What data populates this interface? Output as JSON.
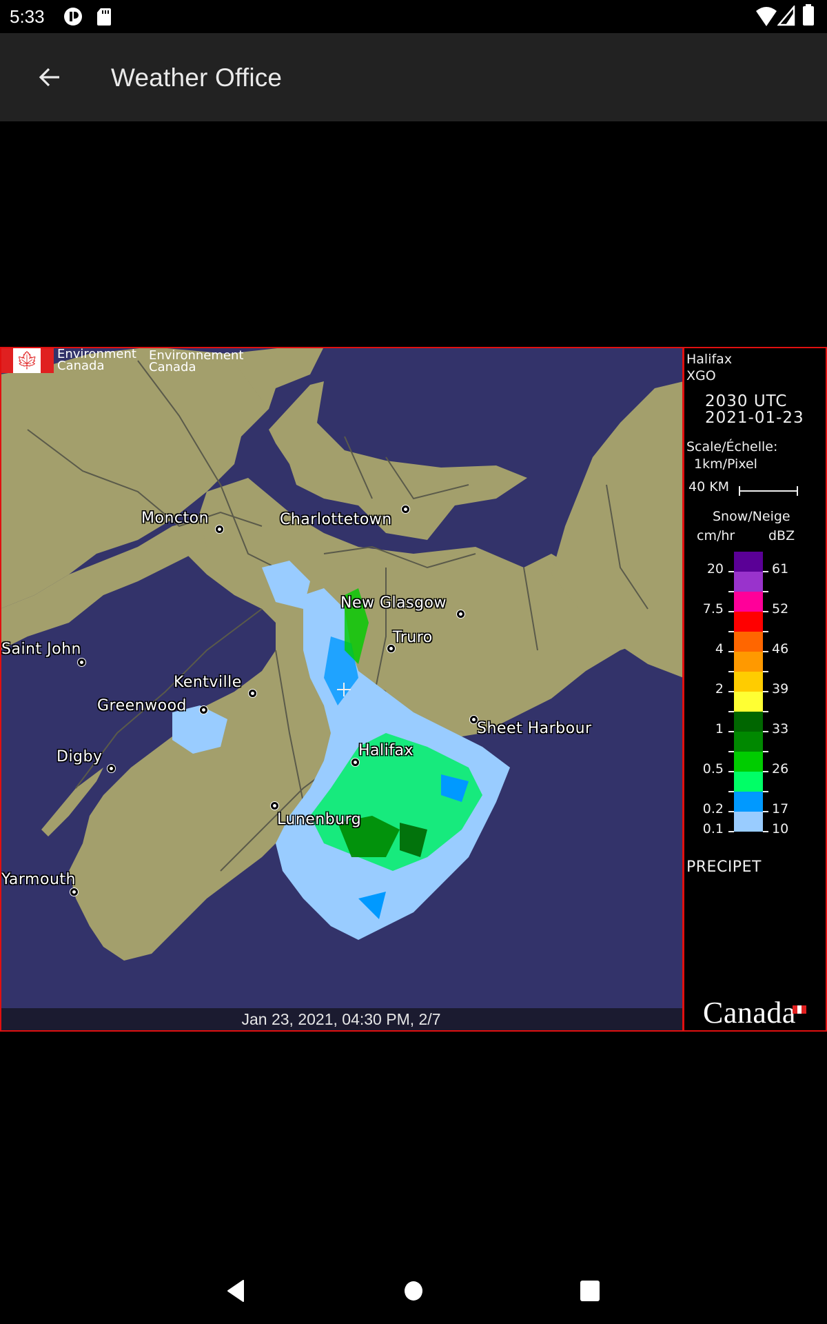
{
  "status_bar": {
    "time": "5:33",
    "left_icons": [
      "app-notification-icon",
      "sd-card-icon"
    ],
    "right_icons": [
      "wifi-icon",
      "cell-signal-icon",
      "battery-icon"
    ]
  },
  "toolbar": {
    "back_icon": "arrow-back-icon",
    "title": "Weather Office"
  },
  "radar": {
    "agency_en": [
      "Environment",
      "Canada"
    ],
    "agency_fr": [
      "Environnement",
      "Canada"
    ],
    "station": "Halifax",
    "station_code": "XGO",
    "time_utc": "2030 UTC",
    "date": "2021-01-23",
    "scale_label": "Scale/Échelle:",
    "scale_value": "1km/Pixel",
    "scale_bar_label": "40 KM",
    "legend_title": "Snow/Neige",
    "legend_unit_left": "cm/hr",
    "legend_unit_right": "dBZ",
    "legend_colors": [
      "#5a0096",
      "#9933cc",
      "#ff0099",
      "#ff0000",
      "#ff6600",
      "#ff9900",
      "#ffcc00",
      "#ffff33",
      "#006600",
      "#008800",
      "#00cc00",
      "#00ff66",
      "#0099ff",
      "#99ccff"
    ],
    "legend_rates": [
      "20",
      "7.5",
      "4",
      "2",
      "1",
      "0.5",
      "0.2",
      "0.1"
    ],
    "legend_dbz": [
      "61",
      "52",
      "46",
      "39",
      "33",
      "26",
      "17",
      "10"
    ],
    "product": "PRECIPET",
    "wordmark": "Canada",
    "cities": [
      {
        "name": "Moncton"
      },
      {
        "name": "Charlottetown"
      },
      {
        "name": "New Glasgow"
      },
      {
        "name": "Truro"
      },
      {
        "name": "Saint John"
      },
      {
        "name": "Kentville"
      },
      {
        "name": "Greenwood"
      },
      {
        "name": "Sheet Harbour"
      },
      {
        "name": "Halifax"
      },
      {
        "name": "Digby"
      },
      {
        "name": "Lunenburg"
      },
      {
        "name": "Yarmouth"
      }
    ],
    "frame_caption": "Jan 23, 2021, 04:30 PM, 2/7",
    "colors": {
      "water": "#33336a",
      "land": "#a39f6c",
      "frame": "#e01010"
    }
  },
  "nav_bar": {
    "back": "nav-back-icon",
    "home": "nav-home-icon",
    "recents": "nav-recents-icon"
  }
}
